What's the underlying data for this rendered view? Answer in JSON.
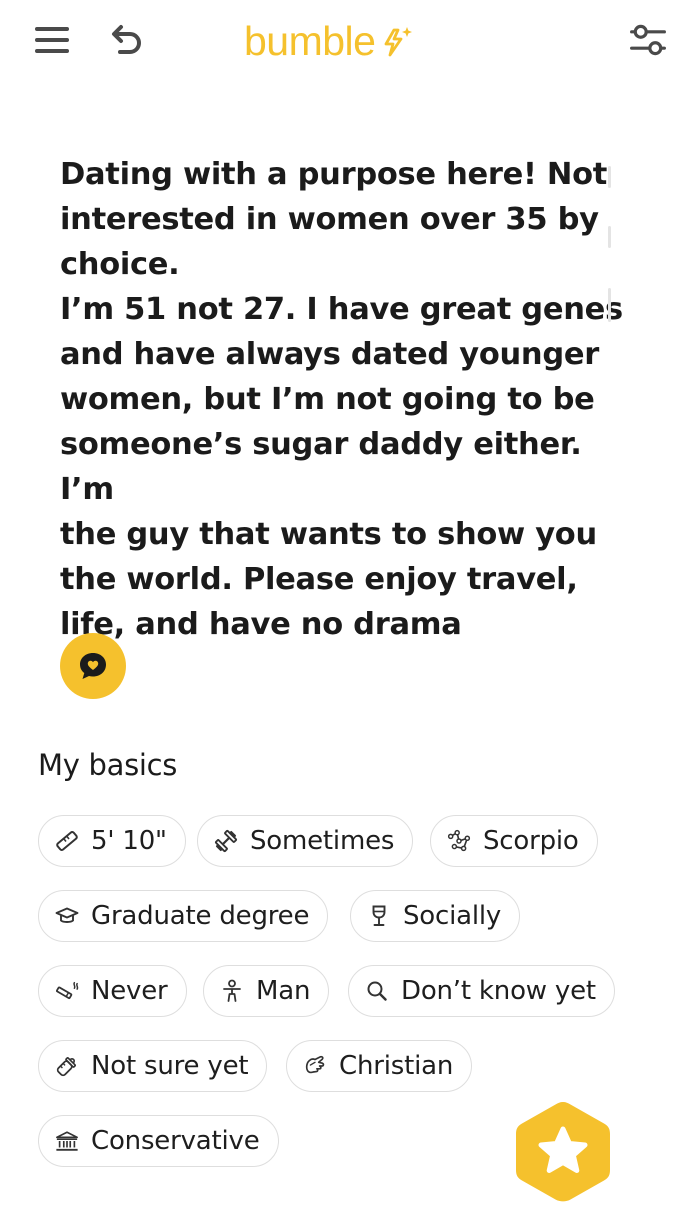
{
  "header": {
    "app_name": "bumble",
    "icons": {
      "menu": "hamburger-menu-icon",
      "undo": "undo-icon",
      "filter": "filter-sliders-icon",
      "logo_spark": "lightning-sparkle-icon"
    },
    "brand_color": "#f5c12d"
  },
  "profile": {
    "bio": "Dating with a purpose here! Not\ninterested in women over 35 by\nchoice.\nI’m 51 not 27. I have great genes\nand have always dated younger\nwomen, but I’m not going to be\nsomeone’s sugar daddy either. I’m\nthe guy that wants to show you\nthe world. Please enjoy travel,\nlife, and have no drama",
    "react_icon": "speech-bubble-heart-icon"
  },
  "basics": {
    "title": "My basics",
    "chips": [
      {
        "label": "5' 10\"",
        "icon": "ruler-icon"
      },
      {
        "label": "Sometimes",
        "icon": "dumbbell-icon"
      },
      {
        "label": "Scorpio",
        "icon": "constellation-icon"
      },
      {
        "label": "Graduate degree",
        "icon": "graduation-cap-icon"
      },
      {
        "label": "Socially",
        "icon": "wine-glass-icon"
      },
      {
        "label": "Never",
        "icon": "smoking-icon"
      },
      {
        "label": "Man",
        "icon": "person-icon"
      },
      {
        "label": "Don’t know yet",
        "icon": "magnifier-icon"
      },
      {
        "label": "Not sure yet",
        "icon": "baby-bottle-icon"
      },
      {
        "label": "Christian",
        "icon": "praying-hands-icon"
      },
      {
        "label": "Conservative",
        "icon": "government-building-icon"
      }
    ]
  },
  "fab": {
    "icon": "superswipe-star-icon"
  }
}
